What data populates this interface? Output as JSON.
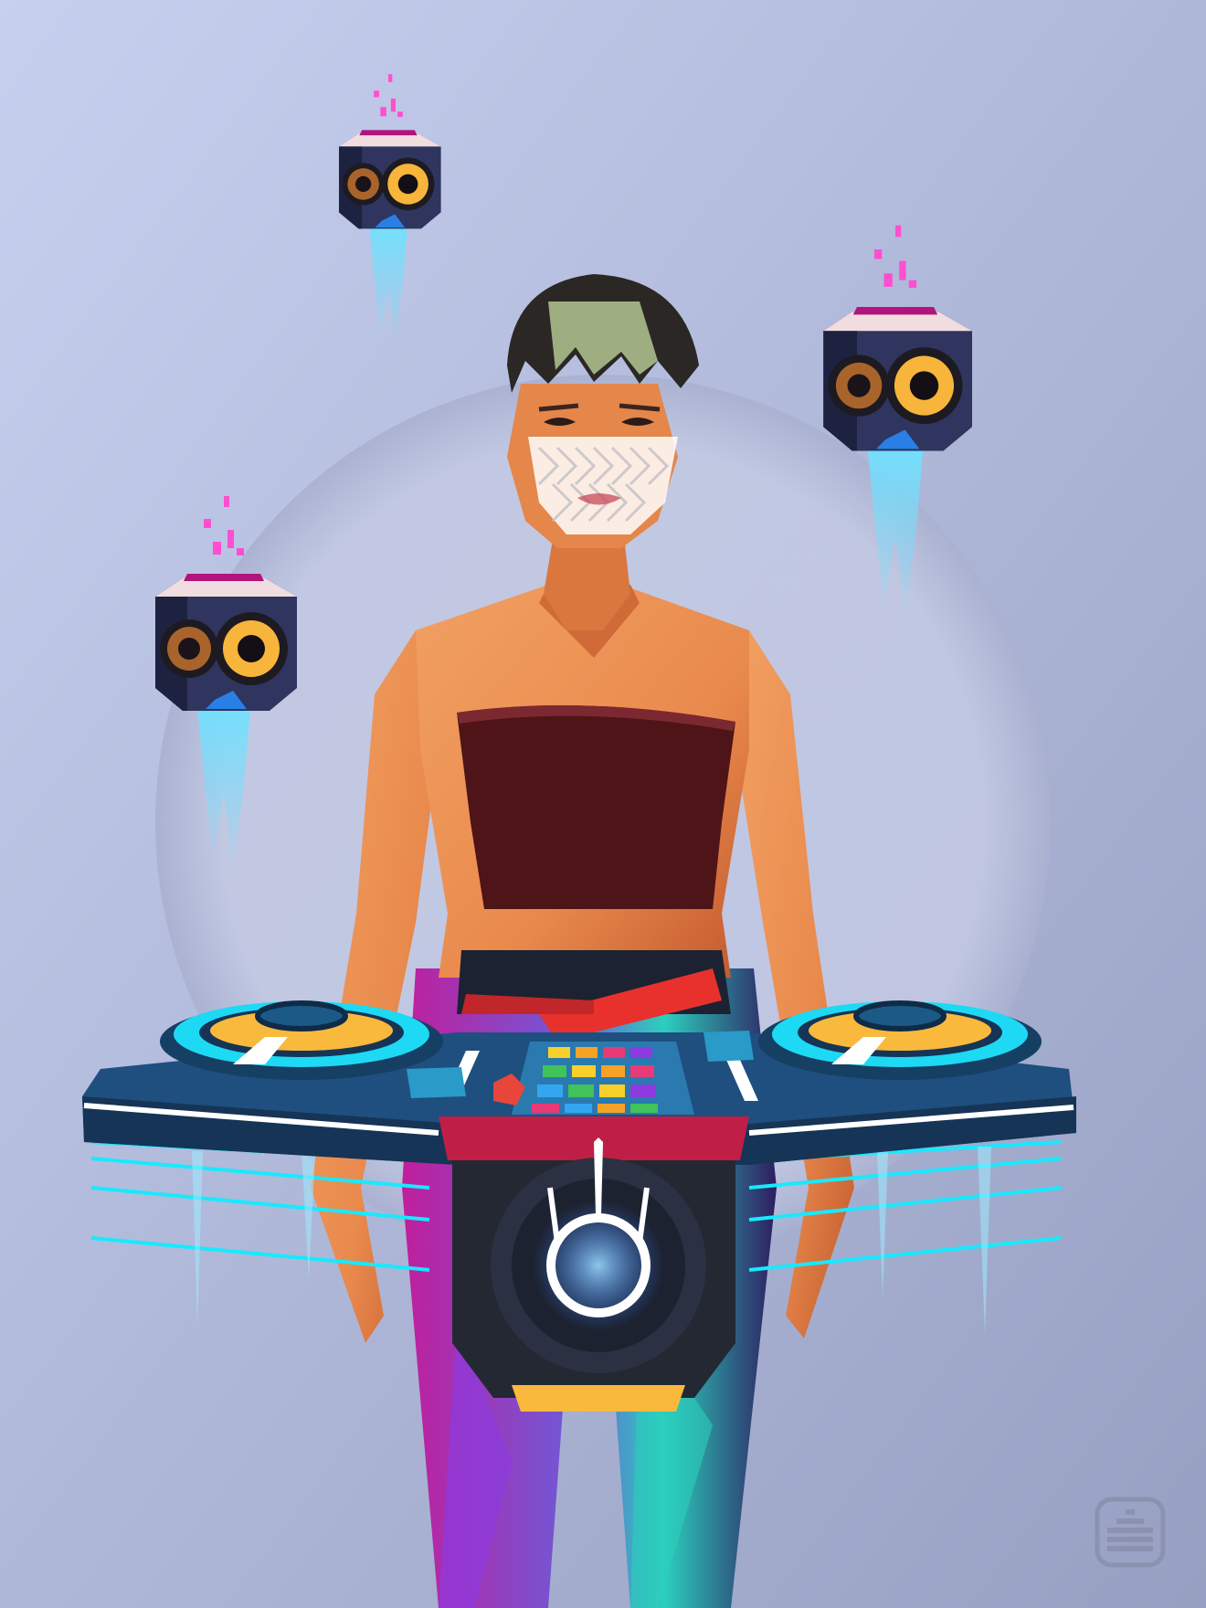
{
  "scene": {
    "background": {
      "from": "#c7d0ef",
      "to": "#97a0c2"
    },
    "halo": "#bdc3de"
  },
  "character": {
    "skin": "#e98a4d",
    "skin_shadow": "#c2592d",
    "hair": "#2b2725",
    "hair_highlight": "#9fae80",
    "mask": "#ffffff",
    "top": "#4f1418",
    "belt": "#e8312d",
    "pants": [
      "#c11e9c",
      "#6f59d8",
      "#2ccfbd",
      "#2e1d61"
    ]
  },
  "dj_console": {
    "deck_body": "#1e4f7f",
    "deck_edge": "#163455",
    "platter_ring": "#1ed9f4",
    "platter": "#f8b93d",
    "trim": "#bf1f47",
    "speaker_face": "#232833",
    "speaker_logo_glow": "#ffffff",
    "neon_lines": "#18e9ff",
    "pad_colors": [
      "#f7d02b",
      "#f6a227",
      "#e93a77",
      "#8d3be0",
      "#41c25a",
      "#33a6f0"
    ]
  },
  "floating_speakers": {
    "body": "#2f355e",
    "cone": "#f8b53c",
    "cone_inner": "#a9642b",
    "cap": "#b2137d",
    "particles": "#ff4fd0",
    "thruster": "#6fe1ff"
  },
  "icons": {
    "corner_logo": "equalizer-badge-icon"
  }
}
